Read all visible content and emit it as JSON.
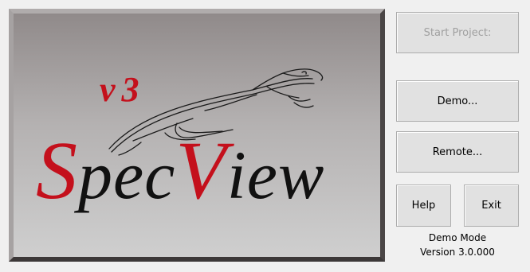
{
  "splash": {
    "version_mark": "v3",
    "product_part1": "Spec",
    "product_part2": "View",
    "colors": {
      "accent_red": "#c4101c",
      "ink_black": "#111111"
    }
  },
  "buttons": {
    "start_project": "Start Project:",
    "demo": "Demo...",
    "remote": "Remote...",
    "help": "Help",
    "exit": "Exit"
  },
  "status": {
    "mode": "Demo Mode",
    "version": "Version 3.0.000"
  }
}
